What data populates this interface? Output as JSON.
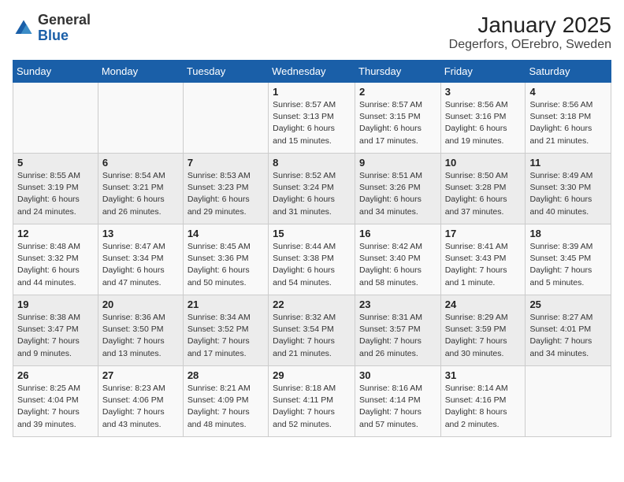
{
  "header": {
    "logo_line1": "General",
    "logo_line2": "Blue",
    "title": "January 2025",
    "subtitle": "Degerfors, OErebro, Sweden"
  },
  "calendar": {
    "days_of_week": [
      "Sunday",
      "Monday",
      "Tuesday",
      "Wednesday",
      "Thursday",
      "Friday",
      "Saturday"
    ],
    "weeks": [
      [
        {
          "day": "",
          "info": ""
        },
        {
          "day": "",
          "info": ""
        },
        {
          "day": "",
          "info": ""
        },
        {
          "day": "1",
          "info": "Sunrise: 8:57 AM\nSunset: 3:13 PM\nDaylight: 6 hours\nand 15 minutes."
        },
        {
          "day": "2",
          "info": "Sunrise: 8:57 AM\nSunset: 3:15 PM\nDaylight: 6 hours\nand 17 minutes."
        },
        {
          "day": "3",
          "info": "Sunrise: 8:56 AM\nSunset: 3:16 PM\nDaylight: 6 hours\nand 19 minutes."
        },
        {
          "day": "4",
          "info": "Sunrise: 8:56 AM\nSunset: 3:18 PM\nDaylight: 6 hours\nand 21 minutes."
        }
      ],
      [
        {
          "day": "5",
          "info": "Sunrise: 8:55 AM\nSunset: 3:19 PM\nDaylight: 6 hours\nand 24 minutes."
        },
        {
          "day": "6",
          "info": "Sunrise: 8:54 AM\nSunset: 3:21 PM\nDaylight: 6 hours\nand 26 minutes."
        },
        {
          "day": "7",
          "info": "Sunrise: 8:53 AM\nSunset: 3:23 PM\nDaylight: 6 hours\nand 29 minutes."
        },
        {
          "day": "8",
          "info": "Sunrise: 8:52 AM\nSunset: 3:24 PM\nDaylight: 6 hours\nand 31 minutes."
        },
        {
          "day": "9",
          "info": "Sunrise: 8:51 AM\nSunset: 3:26 PM\nDaylight: 6 hours\nand 34 minutes."
        },
        {
          "day": "10",
          "info": "Sunrise: 8:50 AM\nSunset: 3:28 PM\nDaylight: 6 hours\nand 37 minutes."
        },
        {
          "day": "11",
          "info": "Sunrise: 8:49 AM\nSunset: 3:30 PM\nDaylight: 6 hours\nand 40 minutes."
        }
      ],
      [
        {
          "day": "12",
          "info": "Sunrise: 8:48 AM\nSunset: 3:32 PM\nDaylight: 6 hours\nand 44 minutes."
        },
        {
          "day": "13",
          "info": "Sunrise: 8:47 AM\nSunset: 3:34 PM\nDaylight: 6 hours\nand 47 minutes."
        },
        {
          "day": "14",
          "info": "Sunrise: 8:45 AM\nSunset: 3:36 PM\nDaylight: 6 hours\nand 50 minutes."
        },
        {
          "day": "15",
          "info": "Sunrise: 8:44 AM\nSunset: 3:38 PM\nDaylight: 6 hours\nand 54 minutes."
        },
        {
          "day": "16",
          "info": "Sunrise: 8:42 AM\nSunset: 3:40 PM\nDaylight: 6 hours\nand 58 minutes."
        },
        {
          "day": "17",
          "info": "Sunrise: 8:41 AM\nSunset: 3:43 PM\nDaylight: 7 hours\nand 1 minute."
        },
        {
          "day": "18",
          "info": "Sunrise: 8:39 AM\nSunset: 3:45 PM\nDaylight: 7 hours\nand 5 minutes."
        }
      ],
      [
        {
          "day": "19",
          "info": "Sunrise: 8:38 AM\nSunset: 3:47 PM\nDaylight: 7 hours\nand 9 minutes."
        },
        {
          "day": "20",
          "info": "Sunrise: 8:36 AM\nSunset: 3:50 PM\nDaylight: 7 hours\nand 13 minutes."
        },
        {
          "day": "21",
          "info": "Sunrise: 8:34 AM\nSunset: 3:52 PM\nDaylight: 7 hours\nand 17 minutes."
        },
        {
          "day": "22",
          "info": "Sunrise: 8:32 AM\nSunset: 3:54 PM\nDaylight: 7 hours\nand 21 minutes."
        },
        {
          "day": "23",
          "info": "Sunrise: 8:31 AM\nSunset: 3:57 PM\nDaylight: 7 hours\nand 26 minutes."
        },
        {
          "day": "24",
          "info": "Sunrise: 8:29 AM\nSunset: 3:59 PM\nDaylight: 7 hours\nand 30 minutes."
        },
        {
          "day": "25",
          "info": "Sunrise: 8:27 AM\nSunset: 4:01 PM\nDaylight: 7 hours\nand 34 minutes."
        }
      ],
      [
        {
          "day": "26",
          "info": "Sunrise: 8:25 AM\nSunset: 4:04 PM\nDaylight: 7 hours\nand 39 minutes."
        },
        {
          "day": "27",
          "info": "Sunrise: 8:23 AM\nSunset: 4:06 PM\nDaylight: 7 hours\nand 43 minutes."
        },
        {
          "day": "28",
          "info": "Sunrise: 8:21 AM\nSunset: 4:09 PM\nDaylight: 7 hours\nand 48 minutes."
        },
        {
          "day": "29",
          "info": "Sunrise: 8:18 AM\nSunset: 4:11 PM\nDaylight: 7 hours\nand 52 minutes."
        },
        {
          "day": "30",
          "info": "Sunrise: 8:16 AM\nSunset: 4:14 PM\nDaylight: 7 hours\nand 57 minutes."
        },
        {
          "day": "31",
          "info": "Sunrise: 8:14 AM\nSunset: 4:16 PM\nDaylight: 8 hours\nand 2 minutes."
        },
        {
          "day": "",
          "info": ""
        }
      ]
    ]
  }
}
